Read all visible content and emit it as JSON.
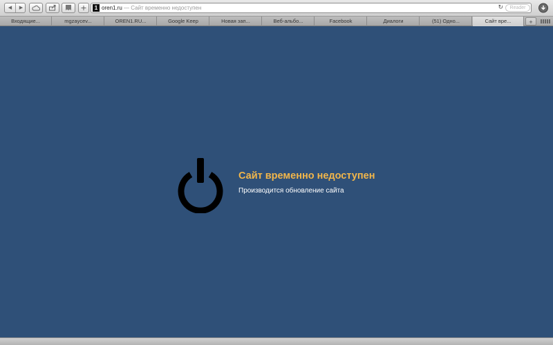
{
  "toolbar": {
    "back_icon": "back-arrow-icon",
    "forward_icon": "forward-arrow-icon",
    "icloud_icon": "cloud-icon",
    "share_icon": "share-icon",
    "bookmarks_icon": "bookmarks-icon",
    "add_label": "+",
    "reader_label": "Reader"
  },
  "address": {
    "favicon_text": "1",
    "domain": "oren1.ru",
    "separator": " — ",
    "page_title": "Сайт временно недоступен"
  },
  "tabs": [
    {
      "label": "Входящие..."
    },
    {
      "label": "mgzaycev..."
    },
    {
      "label": "OREN1.RU..."
    },
    {
      "label": "Google Keep"
    },
    {
      "label": "Новая зап..."
    },
    {
      "label": "Веб-альбо..."
    },
    {
      "label": "Facebook"
    },
    {
      "label": "Диалоги"
    },
    {
      "label": "(51) Одно..."
    },
    {
      "label": "Сайт вре...",
      "active": true
    }
  ],
  "new_tab_label": "+",
  "page": {
    "title": "Сайт временно недоступен",
    "subtitle": "Производится обновление сайта",
    "icon": "power-icon",
    "background": "#2f5078",
    "title_color": "#f2b64a"
  }
}
